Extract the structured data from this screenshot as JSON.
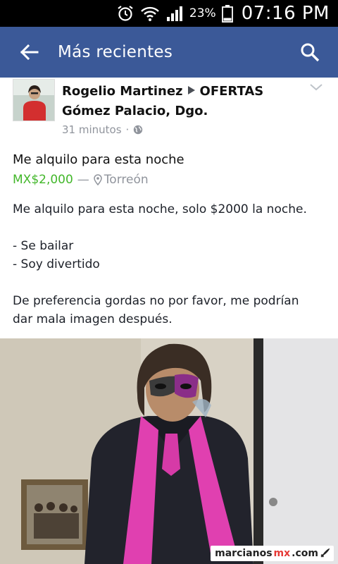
{
  "status_bar": {
    "battery_percent": "23%",
    "time": "07:16 PM"
  },
  "app_bar": {
    "title": "Más recientes"
  },
  "post": {
    "author": "Rogelio Martinez",
    "group": "OFERTAS",
    "location": "Gómez Palacio, Dgo.",
    "timestamp": "31 minutos",
    "separator": "·",
    "listing": {
      "title": "Me alquilo para esta noche",
      "price": "MX$2,000",
      "dash": "—",
      "city": "Torreón"
    },
    "body": {
      "line1": "Me alquilo para esta noche, solo $2000 la noche.",
      "line2": "- Se bailar",
      "line3": "- Soy divertido",
      "line4": "De preferencia gordas no por favor, me podrían dar mala imagen después."
    }
  },
  "watermark": {
    "part1": "marcianos",
    "part2": "mx",
    "part3": ".com"
  },
  "colors": {
    "brand": "#3b5998",
    "price_green": "#42b72a",
    "meta_gray": "#90949c"
  }
}
